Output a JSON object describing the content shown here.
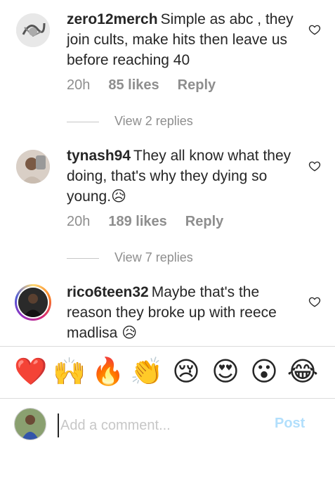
{
  "comments": [
    {
      "username": "zero12merch",
      "text": "Simple as abc , they join cults, make hits then leave us before reaching 40",
      "time": "20h",
      "likes": "85 likes",
      "reply": "Reply"
    },
    {
      "username": "tynash94",
      "text": "They all know what they doing, that's why they dying so young.",
      "emoji": "😥",
      "time": "20h",
      "likes": "189 likes",
      "reply": "Reply"
    },
    {
      "username": "rico6teen32",
      "text": "Maybe that's the reason they broke up with reece madlisa",
      "emoji": "😥"
    }
  ],
  "view_replies": [
    "View 2 replies",
    "View 7 replies"
  ],
  "emoji_bar": [
    "❤️",
    "🙌",
    "🔥",
    "👏",
    "😢",
    "😍",
    "😮",
    "😂"
  ],
  "composer": {
    "placeholder": "Add a comment...",
    "post_label": "Post"
  },
  "colors": {
    "muted": "#8e8e8e",
    "text": "#262626",
    "post_disabled": "#b2dffc"
  }
}
